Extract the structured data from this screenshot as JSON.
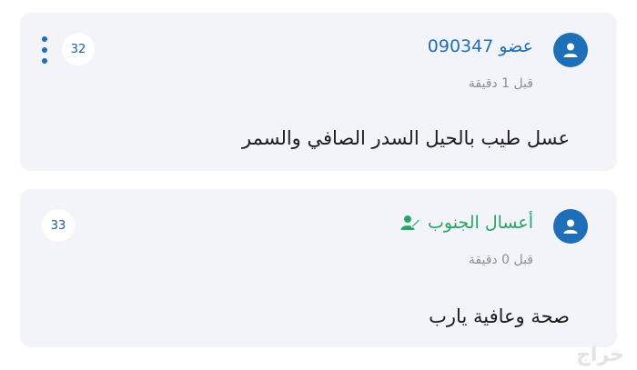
{
  "comments": [
    {
      "author": "عضو 090347",
      "time": "قبل 1 دقيقة",
      "text": "عسل طيب بالحيل السدر الصافي والسمر",
      "number": "32",
      "author_color": "#1f6fb8",
      "icon": "user-icon"
    },
    {
      "author": "أعسال الجنوب",
      "time": "قبل 0 دقيقة",
      "text": "صحة وعافية يارب",
      "number": "33",
      "author_color": "#27a567",
      "icon": "user-icon",
      "badge_icon": "verified-user-icon"
    }
  ],
  "watermark": "حراج"
}
